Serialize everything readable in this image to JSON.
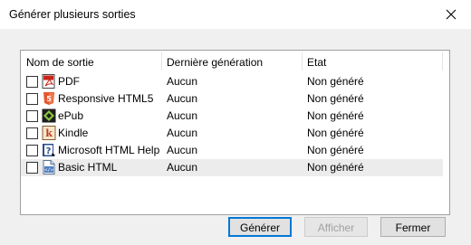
{
  "window": {
    "title": "Générer plusieurs sorties",
    "close_icon": "close-icon"
  },
  "columns": [
    "Nom de sortie",
    "Dernière génération",
    "Etat"
  ],
  "rows": [
    {
      "name": "PDF",
      "last": "Aucun",
      "state": "Non généré",
      "icon": "pdf-icon",
      "checked": false
    },
    {
      "name": "Responsive HTML5",
      "last": "Aucun",
      "state": "Non généré",
      "icon": "html5-icon",
      "checked": false
    },
    {
      "name": "ePub",
      "last": "Aucun",
      "state": "Non généré",
      "icon": "epub-icon",
      "checked": false
    },
    {
      "name": "Kindle",
      "last": "Aucun",
      "state": "Non généré",
      "icon": "kindle-icon",
      "checked": false
    },
    {
      "name": "Microsoft HTML Help",
      "last": "Aucun",
      "state": "Non généré",
      "icon": "htmlhelp-icon",
      "checked": false
    },
    {
      "name": "Basic HTML",
      "last": "Aucun",
      "state": "Non généré",
      "icon": "basic-html-icon",
      "checked": false
    }
  ],
  "buttons": {
    "generate": "Générer",
    "view": "Afficher",
    "close": "Fermer"
  },
  "colors": {
    "accent": "#0078d7",
    "row_highlight": "#ececec"
  }
}
